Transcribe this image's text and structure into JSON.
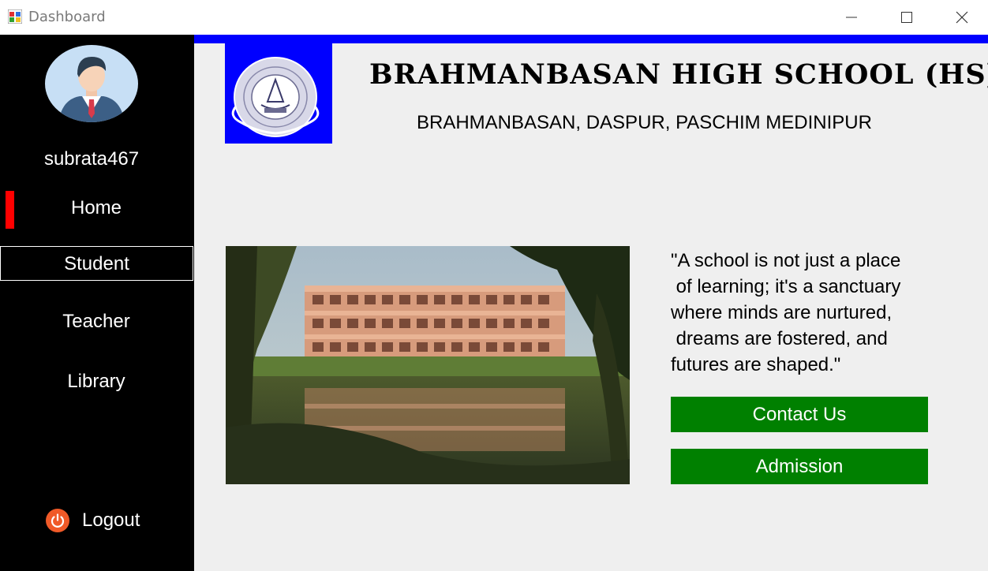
{
  "window": {
    "title": "Dashboard"
  },
  "sidebar": {
    "username": "subrata467",
    "items": [
      {
        "label": "Home",
        "active": true
      },
      {
        "label": "Student"
      },
      {
        "label": "Teacher"
      },
      {
        "label": "Library"
      }
    ],
    "logout_label": "Logout"
  },
  "header": {
    "school_name": "BRAHMANBASAN HIGH SCHOOL (HS)",
    "address": "BRAHMANBASAN, DASPUR, PASCHIM MEDINIPUR"
  },
  "main": {
    "quote": "\"A school is not just a place\n of learning; it's a sanctuary\nwhere minds are nurtured,\n dreams are fostered, and\nfutures are shaped.\"",
    "contact_label": "Contact Us",
    "admission_label": "Admission"
  },
  "colors": {
    "sidebar_bg": "#000000",
    "accent_blue": "#0000ff",
    "active_indicator": "#ff0000",
    "button_green": "#008000",
    "main_bg": "#efefef",
    "logout_icon": "#f05a28"
  },
  "icons": {
    "app": "app-icon",
    "minimize": "minimize-icon",
    "maximize": "maximize-icon",
    "close": "close-icon",
    "logout": "power-icon",
    "avatar": "user-avatar"
  }
}
